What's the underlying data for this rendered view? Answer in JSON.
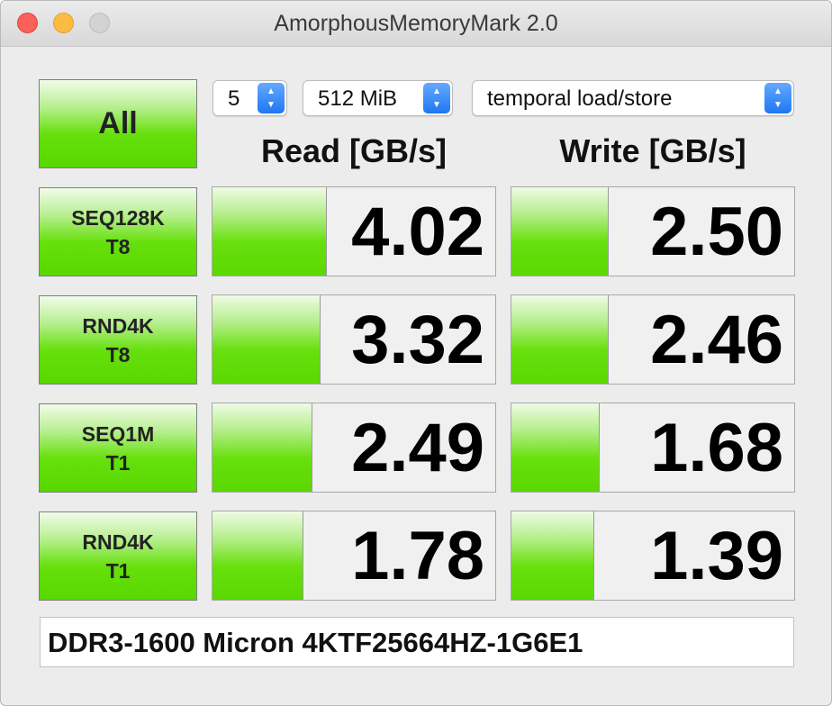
{
  "window": {
    "title": "AmorphousMemoryMark 2.0"
  },
  "controls": {
    "all_label": "All",
    "count": "5",
    "size": "512 MiB",
    "mode": "temporal load/store"
  },
  "headers": {
    "read": "Read [GB/s]",
    "write": "Write [GB/s]"
  },
  "tests": [
    {
      "line1": "SEQ128K",
      "line2": "T8",
      "read": "4.02",
      "write": "2.50",
      "read_level": 0.4,
      "write_level": 0.34
    },
    {
      "line1": "RND4K",
      "line2": "T8",
      "read": "3.32",
      "write": "2.46",
      "read_level": 0.38,
      "write_level": 0.34
    },
    {
      "line1": "SEQ1M",
      "line2": "T1",
      "read": "2.49",
      "write": "1.68",
      "read_level": 0.35,
      "write_level": 0.31
    },
    {
      "line1": "RND4K",
      "line2": "T1",
      "read": "1.78",
      "write": "1.39",
      "read_level": 0.32,
      "write_level": 0.29
    }
  ],
  "comment": "DDR3-1600 Micron 4KTF25664HZ-1G6E1",
  "colors": {
    "bar_green": "#5ad800",
    "close": "#fc605b",
    "minimize": "#fdbc40",
    "stepper_blue": "#1f77f2"
  },
  "icons": {
    "stepper": "updown-chevron-icon"
  }
}
